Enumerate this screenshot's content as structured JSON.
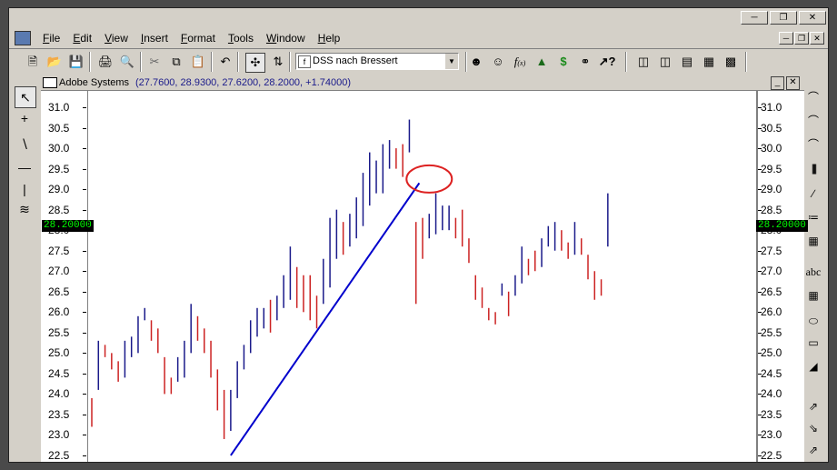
{
  "window": {
    "menu": [
      "File",
      "Edit",
      "View",
      "Insert",
      "Format",
      "Tools",
      "Window",
      "Help"
    ],
    "title_buttons": [
      "minimize",
      "restore",
      "close"
    ],
    "doc_buttons": [
      "minimize",
      "restore",
      "close"
    ]
  },
  "toolbar": {
    "indicator_select": "DSS nach Bressert",
    "icons": [
      "new-icon",
      "open-icon",
      "save-icon",
      "print-icon",
      "print-preview-icon",
      "cut-icon",
      "copy-icon",
      "paste-icon",
      "undo-icon",
      "crosshair-icon",
      "indicator-icon",
      "expert-icon",
      "function-icon",
      "chart-analysis-icon",
      "dollar-icon",
      "binoculars-icon",
      "help-icon",
      "window-icon",
      "tile-vertical-icon",
      "tile-horizontal-icon",
      "tile-grid-icon",
      "cascade-icon"
    ]
  },
  "chart_window": {
    "title_prefix": "Adobe Systems",
    "title_values": "(27.7600, 28.9300, 27.6200, 28.2000, +1.74000)",
    "price_tag_left": "28.20000",
    "price_tag_right": "28.20000"
  },
  "chart_data": {
    "type": "ohlc-bar",
    "title": "Adobe Systems",
    "ylim": [
      22.3,
      31.4
    ],
    "yticks": [
      "31.0",
      "30.5",
      "30.0",
      "29.5",
      "29.0",
      "28.5",
      "28.0",
      "27.5",
      "27.0",
      "26.5",
      "26.0",
      "25.5",
      "25.0",
      "24.5",
      "24.0",
      "23.5",
      "23.0",
      "22.5"
    ],
    "colors": {
      "up": "#1a1a8a",
      "down": "#cc2222",
      "trendline": "#0000cc",
      "circle": "#dd2222"
    },
    "bars": [
      {
        "h": 23.9,
        "l": 23.2,
        "dir": "down"
      },
      {
        "h": 25.3,
        "l": 24.1,
        "dir": "up"
      },
      {
        "h": 25.2,
        "l": 24.9,
        "dir": "down"
      },
      {
        "h": 25.0,
        "l": 24.6,
        "dir": "down"
      },
      {
        "h": 24.8,
        "l": 24.3,
        "dir": "down"
      },
      {
        "h": 25.3,
        "l": 24.4,
        "dir": "up"
      },
      {
        "h": 25.4,
        "l": 24.9,
        "dir": "up"
      },
      {
        "h": 25.9,
        "l": 25.0,
        "dir": "up"
      },
      {
        "h": 26.1,
        "l": 25.8,
        "dir": "up"
      },
      {
        "h": 25.8,
        "l": 25.3,
        "dir": "down"
      },
      {
        "h": 25.6,
        "l": 25.0,
        "dir": "down"
      },
      {
        "h": 24.9,
        "l": 24.0,
        "dir": "down"
      },
      {
        "h": 24.4,
        "l": 24.0,
        "dir": "down"
      },
      {
        "h": 24.9,
        "l": 24.3,
        "dir": "up"
      },
      {
        "h": 25.3,
        "l": 24.4,
        "dir": "up"
      },
      {
        "h": 26.2,
        "l": 25.0,
        "dir": "up"
      },
      {
        "h": 25.9,
        "l": 25.3,
        "dir": "down"
      },
      {
        "h": 25.6,
        "l": 25.0,
        "dir": "down"
      },
      {
        "h": 25.3,
        "l": 24.4,
        "dir": "down"
      },
      {
        "h": 24.6,
        "l": 23.6,
        "dir": "down"
      },
      {
        "h": 24.1,
        "l": 22.9,
        "dir": "down"
      },
      {
        "h": 24.1,
        "l": 23.1,
        "dir": "up"
      },
      {
        "h": 24.8,
        "l": 23.9,
        "dir": "up"
      },
      {
        "h": 25.2,
        "l": 24.6,
        "dir": "up"
      },
      {
        "h": 25.8,
        "l": 25.0,
        "dir": "up"
      },
      {
        "h": 26.1,
        "l": 25.4,
        "dir": "up"
      },
      {
        "h": 26.1,
        "l": 25.6,
        "dir": "up"
      },
      {
        "h": 26.3,
        "l": 25.5,
        "dir": "down"
      },
      {
        "h": 26.4,
        "l": 25.8,
        "dir": "up"
      },
      {
        "h": 26.9,
        "l": 26.1,
        "dir": "up"
      },
      {
        "h": 27.6,
        "l": 26.3,
        "dir": "up"
      },
      {
        "h": 27.1,
        "l": 26.1,
        "dir": "down"
      },
      {
        "h": 26.9,
        "l": 26.0,
        "dir": "down"
      },
      {
        "h": 26.9,
        "l": 25.8,
        "dir": "down"
      },
      {
        "h": 26.4,
        "l": 25.6,
        "dir": "down"
      },
      {
        "h": 27.3,
        "l": 26.2,
        "dir": "up"
      },
      {
        "h": 28.3,
        "l": 26.6,
        "dir": "up"
      },
      {
        "h": 28.5,
        "l": 27.3,
        "dir": "up"
      },
      {
        "h": 28.2,
        "l": 27.4,
        "dir": "down"
      },
      {
        "h": 28.4,
        "l": 27.6,
        "dir": "up"
      },
      {
        "h": 28.8,
        "l": 27.8,
        "dir": "up"
      },
      {
        "h": 29.4,
        "l": 28.1,
        "dir": "up"
      },
      {
        "h": 29.9,
        "l": 28.6,
        "dir": "up"
      },
      {
        "h": 29.7,
        "l": 28.9,
        "dir": "up"
      },
      {
        "h": 30.1,
        "l": 28.9,
        "dir": "up"
      },
      {
        "h": 30.2,
        "l": 29.5,
        "dir": "up"
      },
      {
        "h": 30.0,
        "l": 29.5,
        "dir": "down"
      },
      {
        "h": 30.1,
        "l": 29.3,
        "dir": "down"
      },
      {
        "h": 30.7,
        "l": 29.9,
        "dir": "up"
      },
      {
        "h": 28.2,
        "l": 26.2,
        "dir": "down"
      },
      {
        "h": 28.3,
        "l": 27.3,
        "dir": "down"
      },
      {
        "h": 28.4,
        "l": 27.8,
        "dir": "up"
      },
      {
        "h": 28.9,
        "l": 27.9,
        "dir": "up"
      },
      {
        "h": 28.6,
        "l": 28.0,
        "dir": "up"
      },
      {
        "h": 28.6,
        "l": 28.0,
        "dir": "up"
      },
      {
        "h": 28.3,
        "l": 27.8,
        "dir": "down"
      },
      {
        "h": 28.5,
        "l": 27.6,
        "dir": "down"
      },
      {
        "h": 27.8,
        "l": 27.2,
        "dir": "down"
      },
      {
        "h": 26.9,
        "l": 26.3,
        "dir": "down"
      },
      {
        "h": 26.6,
        "l": 26.1,
        "dir": "down"
      },
      {
        "h": 26.1,
        "l": 25.8,
        "dir": "down"
      },
      {
        "h": 26.0,
        "l": 25.7,
        "dir": "down"
      },
      {
        "h": 26.7,
        "l": 26.4,
        "dir": "up"
      },
      {
        "h": 26.5,
        "l": 25.9,
        "dir": "down"
      },
      {
        "h": 26.9,
        "l": 26.4,
        "dir": "up"
      },
      {
        "h": 27.6,
        "l": 26.7,
        "dir": "up"
      },
      {
        "h": 27.3,
        "l": 26.9,
        "dir": "down"
      },
      {
        "h": 27.5,
        "l": 27.0,
        "dir": "down"
      },
      {
        "h": 27.8,
        "l": 27.1,
        "dir": "up"
      },
      {
        "h": 28.1,
        "l": 27.6,
        "dir": "up"
      },
      {
        "h": 28.2,
        "l": 27.5,
        "dir": "up"
      },
      {
        "h": 28.0,
        "l": 27.5,
        "dir": "down"
      },
      {
        "h": 27.7,
        "l": 27.3,
        "dir": "down"
      },
      {
        "h": 28.2,
        "l": 27.4,
        "dir": "up"
      },
      {
        "h": 27.8,
        "l": 27.4,
        "dir": "down"
      },
      {
        "h": 27.4,
        "l": 26.8,
        "dir": "down"
      },
      {
        "h": 27.0,
        "l": 26.3,
        "dir": "down"
      },
      {
        "h": 26.8,
        "l": 26.4,
        "dir": "down"
      },
      {
        "h": 28.9,
        "l": 27.6,
        "dir": "up"
      }
    ]
  }
}
